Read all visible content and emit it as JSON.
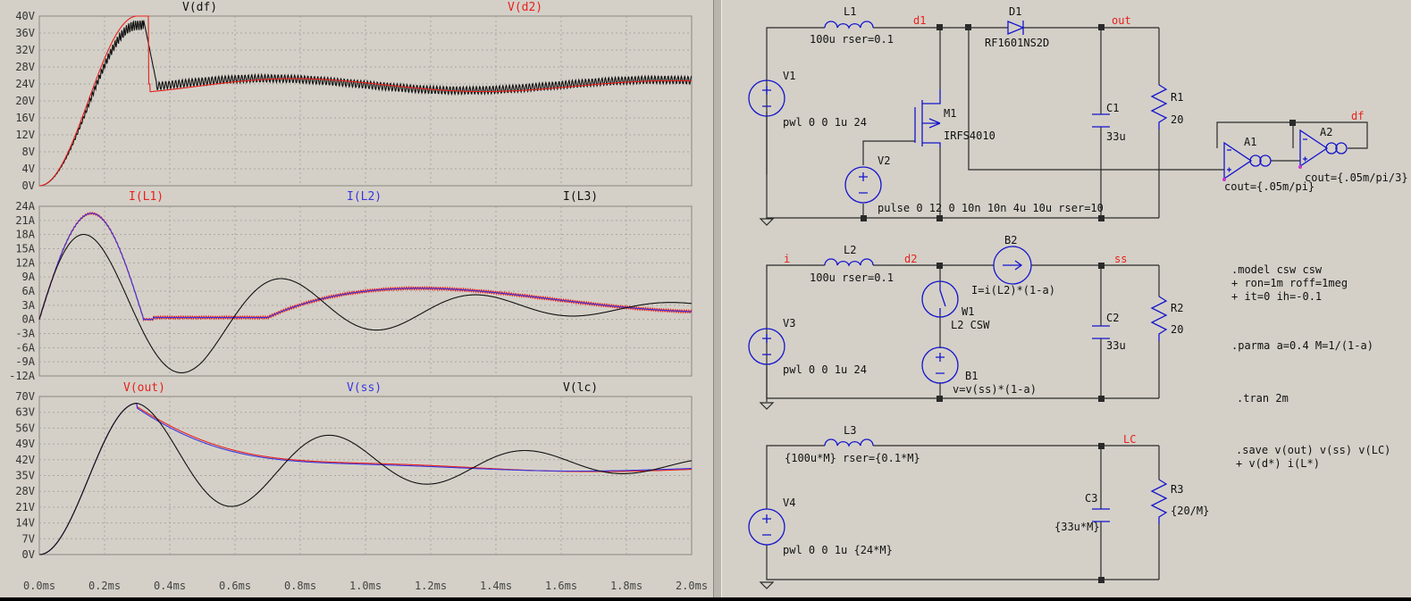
{
  "colors": {
    "bg": "#d4d0c8",
    "grid": "#a9a6a0",
    "red": "#e8211c",
    "blue": "#3b35e0",
    "black": "#111111",
    "wire": "#2a2a2a",
    "comp": "#1515cc"
  },
  "x_ticks": [
    "0.0ms",
    "0.2ms",
    "0.4ms",
    "0.6ms",
    "0.8ms",
    "1.0ms",
    "1.2ms",
    "1.4ms",
    "1.6ms",
    "1.8ms",
    "2.0ms"
  ],
  "chart_data": [
    {
      "type": "line",
      "x_range": [
        0,
        2
      ],
      "ylim": [
        0,
        40
      ],
      "yticks": [
        "0V",
        "4V",
        "8V",
        "12V",
        "16V",
        "20V",
        "24V",
        "28V",
        "32V",
        "36V",
        "40V"
      ],
      "series": [
        {
          "name": "V(df)",
          "color": "black"
        },
        {
          "name": "V(d2)",
          "color": "red"
        }
      ]
    },
    {
      "type": "line",
      "x_range": [
        0,
        2
      ],
      "ylim": [
        -12,
        24
      ],
      "yticks": [
        "-12A",
        "-9A",
        "-6A",
        "-3A",
        "0A",
        "3A",
        "6A",
        "9A",
        "12A",
        "15A",
        "18A",
        "21A",
        "24A"
      ],
      "series": [
        {
          "name": "I(L1)",
          "color": "red"
        },
        {
          "name": "I(L2)",
          "color": "blue"
        },
        {
          "name": "I(L3)",
          "color": "black"
        }
      ]
    },
    {
      "type": "line",
      "x_range": [
        0,
        2
      ],
      "ylim": [
        0,
        70
      ],
      "yticks": [
        "0V",
        "7V",
        "14V",
        "21V",
        "28V",
        "35V",
        "42V",
        "49V",
        "56V",
        "63V",
        "70V"
      ],
      "series": [
        {
          "name": "V(out)",
          "color": "red"
        },
        {
          "name": "V(ss)",
          "color": "blue"
        },
        {
          "name": "V(lc)",
          "color": "black"
        }
      ]
    }
  ],
  "schematic": {
    "labels": {
      "L1": "L1",
      "L1v": "100u rser=0.1",
      "d1": "d1",
      "D1": "D1",
      "D1v": "RF1601NS2D",
      "out": "out",
      "V1": "V1",
      "V1v": "pwl 0 0 1u 24",
      "M1": "M1",
      "M1v": "IRFS4010",
      "C1": "C1",
      "C1v": "33u",
      "R1": "R1",
      "R1v": "20",
      "V2": "V2",
      "V2v": "pulse 0 12 0 10n 10n 4u 10u rser=10",
      "A1": "A1",
      "A1v": "cout={.05m/pi}",
      "A2": "A2",
      "A2v": "cout={.05m/pi/3}",
      "df": "df",
      "i": "i",
      "L2": "L2",
      "L2v": "100u rser=0.1",
      "d2": "d2",
      "B2": "B2",
      "B2v": "I=i(L2)*(1-a)",
      "ss": "ss",
      "W1": "W1",
      "W1v": "L2 CSW",
      "V3": "V3",
      "V3v": "pwl 0 0 1u 24",
      "B1": "B1",
      "B1v": "v=v(ss)*(1-a)",
      "C2": "C2",
      "C2v": "33u",
      "R2": "R2",
      "R2v": "20",
      "L3": "L3",
      "L3v": "{100u*M} rser={0.1*M}",
      "LC": "LC",
      "V4": "V4",
      "V4v": "pwl 0 0 1u {24*M}",
      "C3": "C3",
      "C3v": "{33u*M}",
      "R3": "R3",
      "R3v": "{20/M}"
    },
    "directives": [
      ".model csw csw",
      "+ ron=1m roff=1meg",
      "+ it=0 ih=-0.1",
      ".parma a=0.4 M=1/(1-a)",
      ".tran 2m",
      ".save v(out) v(ss) v(LC)",
      "+ v(d*) i(L*)"
    ]
  }
}
